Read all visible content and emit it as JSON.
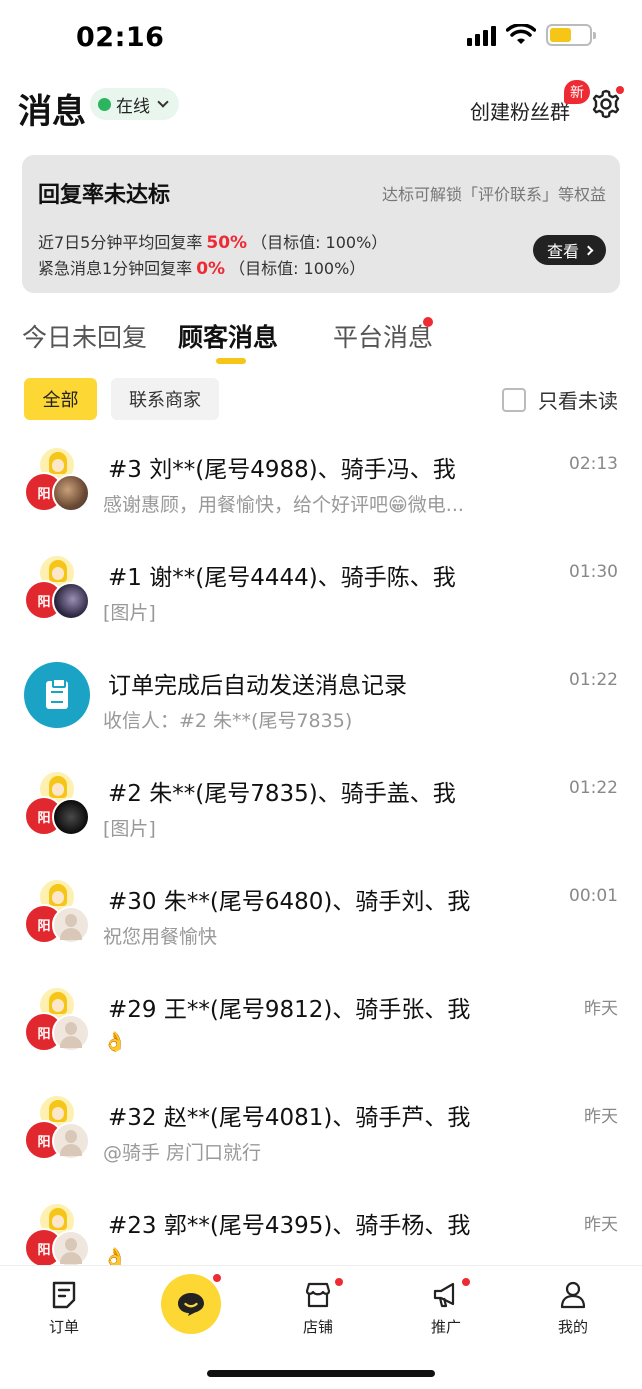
{
  "status_bar": {
    "time": "02:16"
  },
  "header": {
    "title": "消息",
    "online_status": "在线",
    "create_group": "创建粉丝群",
    "new_badge": "新"
  },
  "rate_card": {
    "title": "回复率未达标",
    "hint": "达标可解锁「评价联系」等权益",
    "line1_label": "近7日5分钟平均回复率",
    "line1_value": "50%",
    "line1_target": "（目标值: 100%）",
    "line2_label": "紧急消息1分钟回复率",
    "line2_value": "0%",
    "line2_target": "（目标值: 100%）",
    "view_button": "查看"
  },
  "tabs": [
    {
      "label": "今日未回复"
    },
    {
      "label": "顾客消息"
    },
    {
      "label": "平台消息"
    }
  ],
  "filters": {
    "all": "全部",
    "contact_merchant": "联系商家",
    "unread_only": "只看未读"
  },
  "messages": [
    {
      "title": "#3 刘**(尾号4988)、骑手冯、我",
      "time": "02:13",
      "preview": "感谢惠顾，用餐愉快，给个好评吧😁微电..."
    },
    {
      "title": "#1 谢**(尾号4444)、骑手陈、我",
      "time": "01:30",
      "preview": "[图片]"
    },
    {
      "title": "订单完成后自动发送消息记录",
      "time": "01:22",
      "preview": "收信人：#2 朱**(尾号7835)"
    },
    {
      "title": "#2 朱**(尾号7835)、骑手盖、我",
      "time": "01:22",
      "preview": "[图片]"
    },
    {
      "title": "#30 朱**(尾号6480)、骑手刘、我",
      "time": "00:01",
      "preview": "祝您用餐愉快"
    },
    {
      "title": "#29 王**(尾号9812)、骑手张、我",
      "time": "昨天",
      "preview": "👌"
    },
    {
      "title": "#32 赵**(尾号4081)、骑手芦、我",
      "time": "昨天",
      "preview": "@骑手 房门口就行"
    },
    {
      "title": "#23 郭**(尾号4395)、骑手杨、我",
      "time": "昨天",
      "preview": "👌"
    }
  ],
  "bottom_nav": [
    {
      "label": "订单"
    },
    {
      "label": ""
    },
    {
      "label": "店铺"
    },
    {
      "label": "推广"
    },
    {
      "label": "我的"
    }
  ],
  "colors": {
    "accent": "#fdd835",
    "alert": "#ee2a33",
    "online": "#2bb55e"
  }
}
